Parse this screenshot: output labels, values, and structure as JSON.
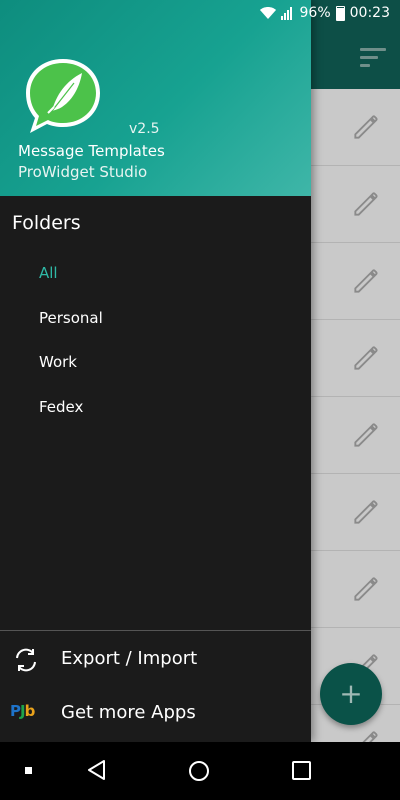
{
  "status_bar": {
    "battery": "96%",
    "time": "00:23"
  },
  "drawer": {
    "version": "v2.5",
    "app_name": "Message Templates",
    "developer": "ProWidget Studio",
    "folders_title": "Folders",
    "folders": [
      {
        "label": "All",
        "active": true
      },
      {
        "label": "Personal",
        "active": false
      },
      {
        "label": "Work",
        "active": false
      },
      {
        "label": "Fedex",
        "active": false
      }
    ],
    "actions": {
      "export_import": "Export / Import",
      "get_more_apps": "Get more Apps"
    }
  },
  "fab": {
    "label": "+"
  },
  "colors": {
    "accent": "#2fb9a6",
    "header_start": "#0e8d7e",
    "toolbar": "#0d4f47",
    "fab": "#0a5248"
  },
  "icons": [
    "wifi-icon",
    "signal-icon",
    "battery-icon",
    "sort-icon",
    "edit-icon",
    "sync-icon",
    "apps-icon"
  ]
}
